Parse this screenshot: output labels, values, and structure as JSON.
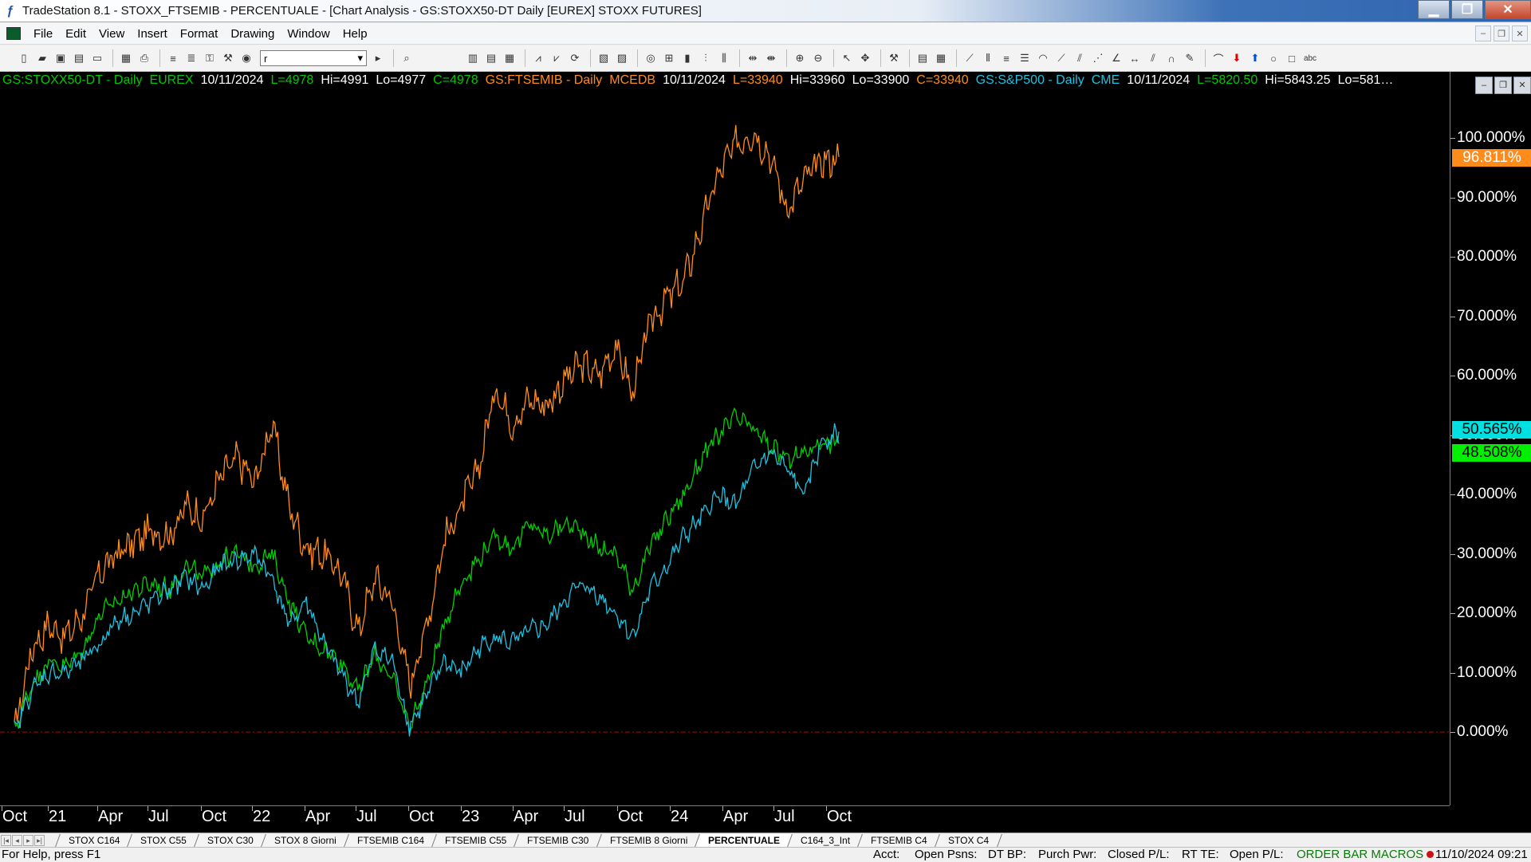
{
  "window": {
    "title": "TradeStation 8.1 - STOXX_FTSEMIB - PERCENTUALE - [Chart Analysis - GS:STOXX50-DT  Daily  [EUREX] STOXX FUTURES]"
  },
  "menu": [
    "File",
    "Edit",
    "View",
    "Insert",
    "Format",
    "Drawing",
    "Window",
    "Help"
  ],
  "toolbar": {
    "symbol_value": "r"
  },
  "chart": {
    "status_segments": [
      {
        "text": "GS:STOXX50-DT - Daily",
        "color": "#00c800"
      },
      {
        "text": "EUREX",
        "color": "#00c800"
      },
      {
        "text": "10/11/2024",
        "color": "#ffffff"
      },
      {
        "text": "L=4978",
        "color": "#00c800"
      },
      {
        "text": "Hi=4991",
        "color": "#ffffff"
      },
      {
        "text": "Lo=4977",
        "color": "#ffffff"
      },
      {
        "text": "C=4978",
        "color": "#00c800"
      },
      {
        "text": "GS:FTSEMIB - Daily",
        "color": "#ff8c1a"
      },
      {
        "text": "MCEDB",
        "color": "#ff8c1a"
      },
      {
        "text": "10/11/2024",
        "color": "#ffffff"
      },
      {
        "text": "L=33940",
        "color": "#ff8c1a"
      },
      {
        "text": "Hi=33960",
        "color": "#ffffff"
      },
      {
        "text": "Lo=33900",
        "color": "#ffffff"
      },
      {
        "text": "C=33940",
        "color": "#ff8c1a"
      },
      {
        "text": "GS:S&P500 - Daily",
        "color": "#20c0e0"
      },
      {
        "text": "CME",
        "color": "#20c0e0"
      },
      {
        "text": "10/11/2024",
        "color": "#ffffff"
      },
      {
        "text": "L=5820.50",
        "color": "#00c800"
      },
      {
        "text": "Hi=5843.25",
        "color": "#ffffff"
      },
      {
        "text": "Lo=581…",
        "color": "#ffffff"
      }
    ],
    "last_values": [
      {
        "text": "96.811%",
        "bg": "#ff8c1a",
        "value": 96.811
      },
      {
        "text": "50.565%",
        "bg": "#00e0e0",
        "value": 50.565
      },
      {
        "text": "48.508%",
        "bg": "#00f000",
        "value": 48.508
      }
    ],
    "sheet_tabs": [
      "STOX C164",
      "STOX C55",
      "STOX  C30",
      "STOX  8 Giorni",
      "FTSEMIB C164",
      "FTSEMIB C55",
      "FTSEMIB C30",
      "FTSEMIB  8 Giorni",
      "PERCENTUALE",
      "C164_3_Int",
      "FTSEMIB C4",
      "STOX  C4"
    ],
    "active_tab": "PERCENTUALE"
  },
  "chart_data": {
    "type": "line",
    "title": "",
    "ylabel": "",
    "y_unit": "%",
    "ylim": [
      -10,
      105
    ],
    "y_ticks": [
      "100.000%",
      "90.000%",
      "80.000%",
      "70.000%",
      "60.000%",
      "50.000%",
      "40.000%",
      "30.000%",
      "20.000%",
      "10.000%",
      "0.000%"
    ],
    "x_ticks": [
      "Oct",
      "21",
      "Apr",
      "Jul",
      "Oct",
      "22",
      "Apr",
      "Jul",
      "Oct",
      "23",
      "Apr",
      "Jul",
      "Oct",
      "24",
      "Apr",
      "Jul",
      "Oct"
    ],
    "reference_line": {
      "y": 0,
      "color": "#c00000",
      "style": "dash-dot"
    },
    "x": [
      "2020-10",
      "2020-11",
      "2020-12",
      "2021-01",
      "2021-02",
      "2021-03",
      "2021-04",
      "2021-05",
      "2021-06",
      "2021-07",
      "2021-08",
      "2021-09",
      "2021-10",
      "2021-11",
      "2021-12",
      "2022-01",
      "2022-02",
      "2022-03",
      "2022-04",
      "2022-05",
      "2022-06",
      "2022-07",
      "2022-08",
      "2022-09",
      "2022-10",
      "2022-11",
      "2022-12",
      "2023-01",
      "2023-02",
      "2023-03",
      "2023-04",
      "2023-05",
      "2023-06",
      "2023-07",
      "2023-08",
      "2023-09",
      "2023-10",
      "2023-11",
      "2023-12",
      "2024-01",
      "2024-02",
      "2024-03",
      "2024-04",
      "2024-05",
      "2024-06",
      "2024-07",
      "2024-08",
      "2024-09",
      "2024-10"
    ],
    "series": [
      {
        "name": "GS:FTSEMIB - Daily",
        "color": "#ff8c1a",
        "values": [
          0,
          14,
          18,
          16,
          20,
          27,
          30,
          32,
          34,
          33,
          38,
          36,
          43,
          46,
          42,
          52,
          38,
          31,
          30,
          27,
          17,
          26,
          22,
          8,
          18,
          32,
          38,
          44,
          58,
          52,
          56,
          55,
          59,
          62,
          60,
          65,
          57,
          69,
          73,
          76,
          85,
          94,
          99,
          101,
          97,
          88,
          93,
          96,
          96.811
        ]
      },
      {
        "name": "GS:STOXX50-DT - Daily",
        "color": "#00d000",
        "values": [
          0,
          8,
          12,
          11,
          14,
          20,
          22,
          24,
          25,
          24,
          28,
          26,
          29,
          30,
          28,
          30,
          22,
          16,
          14,
          12,
          7,
          13,
          9,
          1,
          8,
          18,
          25,
          29,
          33,
          31,
          35,
          33,
          35,
          34,
          31,
          30,
          24,
          31,
          36,
          40,
          46,
          50,
          53,
          51,
          48,
          46,
          47,
          49,
          48.508
        ]
      },
      {
        "name": "GS:S&P500 - Daily",
        "color": "#20c0e0",
        "values": [
          0,
          7,
          10,
          10,
          12,
          15,
          19,
          20,
          22,
          24,
          26,
          24,
          28,
          29,
          30,
          26,
          18,
          22,
          15,
          10,
          5,
          14,
          12,
          1,
          6,
          12,
          10,
          14,
          16,
          15,
          17,
          18,
          22,
          25,
          23,
          20,
          16,
          24,
          28,
          33,
          36,
          40,
          38,
          44,
          47,
          44,
          40,
          49,
          50.565
        ]
      }
    ]
  },
  "statusbar": {
    "help": "For Help, press F1",
    "fields": [
      "Acct:",
      "Open Psns:",
      "DT BP:",
      "Purch Pwr:",
      "Closed P/L:",
      "RT TE:",
      "Open P/L:"
    ],
    "macros": "ORDER BAR  MACROS",
    "datetime": "11/10/2024 09:21"
  }
}
